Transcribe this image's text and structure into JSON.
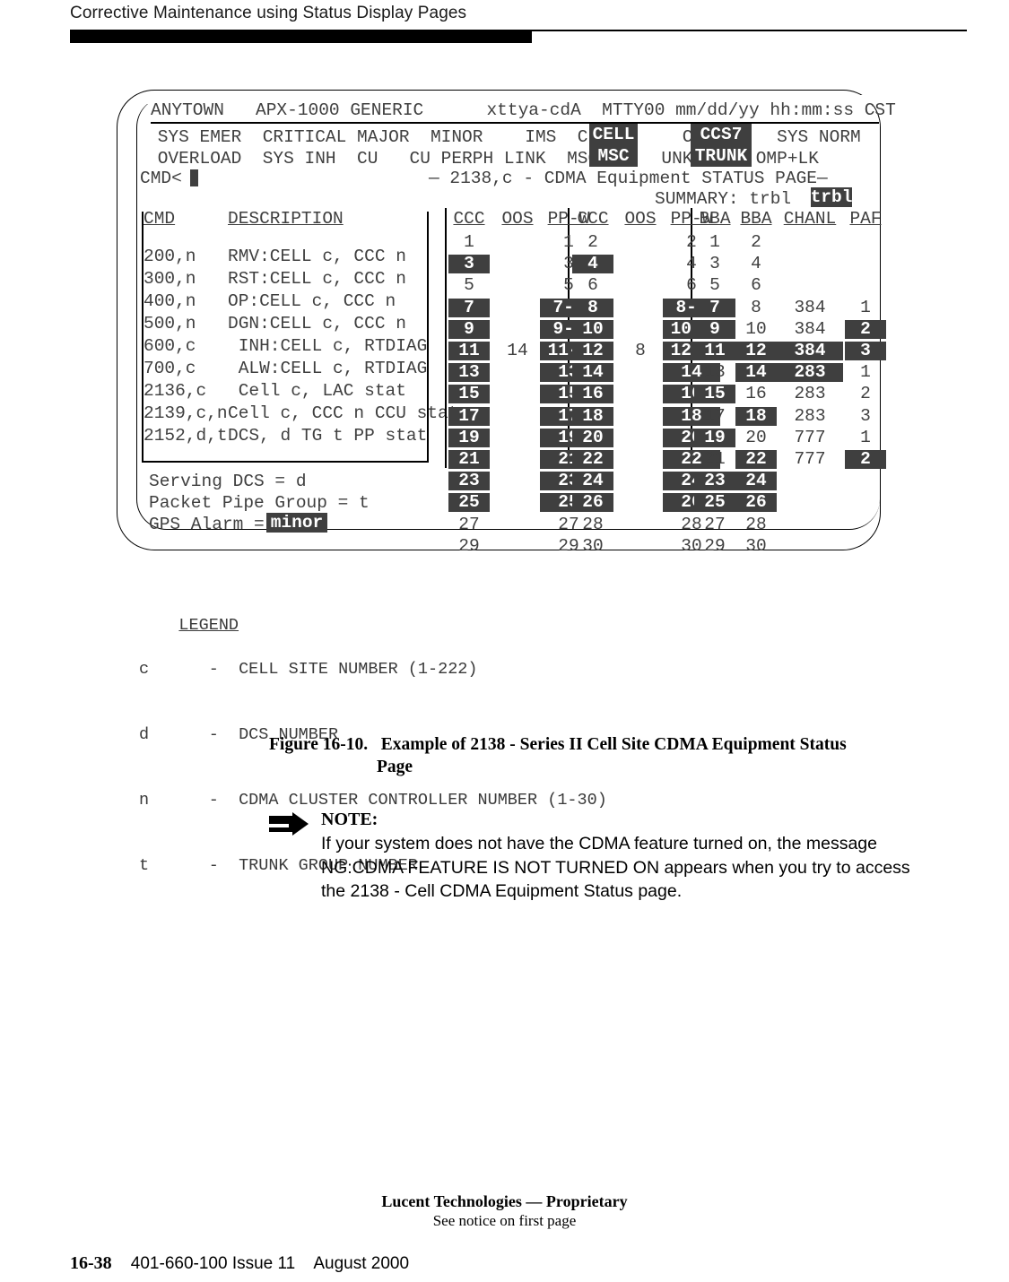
{
  "page": {
    "running_head": "Corrective Maintenance using Status Display Pages",
    "footer_proprietary": "Lucent Technologies — Proprietary",
    "footer_notice": "See notice on first page",
    "footer_page_number": "16-38",
    "footer_doc": "401-660-100 Issue 11",
    "footer_date": "August 2000"
  },
  "terminal": {
    "title_line": {
      "site": "ANYTOWN",
      "generic": "APX-1000 GENERIC",
      "terminal": "xttya-cdA",
      "mtty": "MTTY00",
      "date": "mm/dd/yy",
      "time": "hh:mm:ss",
      "zone": "CST",
      "full": "ANYTOWN   APX-1000 GENERIC      xttya-cdA  MTTY00 mm/dd/yy hh:mm:ss CST"
    },
    "alarm_banner": {
      "row1": " SYS EMER  CRITICAL MAJOR  MINOR    IMS  CELL      CS7      SYS NORM",
      "row2": " OVERLOAD  SYS INH  CU   CU PERPH LINK  MSC D    UNK      OMP+LK",
      "highlights": [
        {
          "line1": "CELL",
          "line2": "MSC"
        },
        {
          "line1": "CCS7",
          "line2": "TRUNK"
        }
      ]
    },
    "cmd_prompt": "CMD<",
    "page_title": "— 2138,c - CDMA Equipment STATUS PAGE—",
    "summary_label": "SUMMARY: trbl",
    "summary_value": "trbl",
    "cmd_table": {
      "headers": {
        "cmd": "CMD",
        "description": "DESCRIPTION"
      },
      "rows": [
        {
          "cmd": "200,n",
          "desc": "RMV:CELL c, CCC n"
        },
        {
          "cmd": "300,n",
          "desc": "RST:CELL c, CCC n"
        },
        {
          "cmd": "400,n",
          "desc": "OP:CELL c, CCC n"
        },
        {
          "cmd": "500,n",
          "desc": "DGN:CELL c, CCC n"
        },
        {
          "cmd": "600,c",
          "desc": " INH:CELL c, RTDIAG"
        },
        {
          "cmd": "700,c",
          "desc": " ALW:CELL c, RTDIAG"
        },
        {
          "cmd": "2136,c",
          "desc": " Cell c, LAC stat"
        },
        {
          "cmd": "2139,c,n",
          "desc": "Cell c, CCC n CCU stat"
        },
        {
          "cmd": "2152,d,t",
          "desc": "DCS, d TG t PP stat"
        }
      ]
    },
    "status_lines": [
      {
        "label": "Serving DCS = d",
        "value": null
      },
      {
        "label": "Packet Pipe Group = t",
        "value": null
      },
      {
        "label": "GPS Alarm = ",
        "value": "minor"
      }
    ],
    "matrix": {
      "group1": {
        "headers": [
          "CCC",
          "OOS",
          "PP-W"
        ],
        "ccc": [
          {
            "t": "1",
            "h": false
          },
          {
            "t": "3",
            "h": true
          },
          {
            "t": "5",
            "h": false
          },
          {
            "t": "7",
            "h": true
          },
          {
            "t": "9",
            "h": true
          },
          {
            "t": "11",
            "h": true
          },
          {
            "t": "13",
            "h": true
          },
          {
            "t": "15",
            "h": true
          },
          {
            "t": "17",
            "h": true
          },
          {
            "t": "19",
            "h": true
          },
          {
            "t": "21",
            "h": true
          },
          {
            "t": "23",
            "h": true
          },
          {
            "t": "25",
            "h": true
          },
          {
            "t": "27",
            "h": false
          },
          {
            "t": "29",
            "h": false
          }
        ],
        "oos": [
          {
            "t": "",
            "h": false
          },
          {
            "t": "",
            "h": false
          },
          {
            "t": "",
            "h": false
          },
          {
            "t": "",
            "h": false
          },
          {
            "t": "",
            "h": false
          },
          {
            "t": "14",
            "h": false
          },
          {
            "t": "",
            "h": false
          },
          {
            "t": "",
            "h": false
          },
          {
            "t": "",
            "h": false
          },
          {
            "t": "",
            "h": false
          },
          {
            "t": "",
            "h": false
          },
          {
            "t": "",
            "h": false
          },
          {
            "t": "",
            "h": false
          },
          {
            "t": "",
            "h": false
          },
          {
            "t": "",
            "h": false
          }
        ],
        "ppw": [
          {
            "t": "1",
            "h": false
          },
          {
            "t": "3",
            "h": false
          },
          {
            "t": "5",
            "h": false
          },
          {
            "t": "7-2",
            "h": true
          },
          {
            "t": "9-8",
            "h": true
          },
          {
            "t": "11-4",
            "h": true
          },
          {
            "t": "13",
            "h": true
          },
          {
            "t": "15",
            "h": true
          },
          {
            "t": "17",
            "h": true
          },
          {
            "t": "19",
            "h": true
          },
          {
            "t": "21",
            "h": true
          },
          {
            "t": "23",
            "h": true
          },
          {
            "t": "25",
            "h": true
          },
          {
            "t": "27",
            "h": false
          },
          {
            "t": "29",
            "h": false
          }
        ]
      },
      "group2": {
        "headers": [
          "CCC",
          "OOS",
          "PP-W"
        ],
        "ccc": [
          {
            "t": "2",
            "h": false
          },
          {
            "t": "4",
            "h": true
          },
          {
            "t": "6",
            "h": false
          },
          {
            "t": "8",
            "h": true
          },
          {
            "t": "10",
            "h": true
          },
          {
            "t": "12",
            "h": true
          },
          {
            "t": "14",
            "h": true
          },
          {
            "t": "16",
            "h": true
          },
          {
            "t": "18",
            "h": true
          },
          {
            "t": "20",
            "h": true
          },
          {
            "t": "22",
            "h": true
          },
          {
            "t": "24",
            "h": true
          },
          {
            "t": "26",
            "h": true
          },
          {
            "t": "28",
            "h": false
          },
          {
            "t": "30",
            "h": false
          }
        ],
        "oos": [
          {
            "t": "",
            "h": false
          },
          {
            "t": "",
            "h": false
          },
          {
            "t": "",
            "h": false
          },
          {
            "t": "",
            "h": false
          },
          {
            "t": "",
            "h": false
          },
          {
            "t": "8",
            "h": false
          },
          {
            "t": "",
            "h": false
          },
          {
            "t": "",
            "h": false
          },
          {
            "t": "",
            "h": false
          },
          {
            "t": "",
            "h": false
          },
          {
            "t": "",
            "h": false
          },
          {
            "t": "",
            "h": false
          },
          {
            "t": "",
            "h": false
          },
          {
            "t": "",
            "h": false
          },
          {
            "t": "",
            "h": false
          }
        ],
        "ppw": [
          {
            "t": "2",
            "h": false
          },
          {
            "t": "4",
            "h": false
          },
          {
            "t": "6",
            "h": false
          },
          {
            "t": "8-6",
            "h": true
          },
          {
            "t": "10-4",
            "h": true
          },
          {
            "t": "12-2",
            "h": true
          },
          {
            "t": "14",
            "h": true
          },
          {
            "t": "16",
            "h": true
          },
          {
            "t": "18",
            "h": true
          },
          {
            "t": "20",
            "h": true
          },
          {
            "t": "22",
            "h": true
          },
          {
            "t": "24",
            "h": true
          },
          {
            "t": "26",
            "h": true
          },
          {
            "t": "28",
            "h": false
          },
          {
            "t": "30",
            "h": false
          }
        ]
      },
      "group3": {
        "headers": [
          "BBA",
          "BBA",
          "CHANL",
          "PAF"
        ],
        "bba_odd": [
          {
            "t": "1",
            "h": false
          },
          {
            "t": "3",
            "h": false
          },
          {
            "t": "5",
            "h": false
          },
          {
            "t": "7",
            "h": true
          },
          {
            "t": "9",
            "h": true
          },
          {
            "t": "11",
            "h": true
          },
          {
            "t": "13",
            "h": false
          },
          {
            "t": "15",
            "h": true
          },
          {
            "t": "17",
            "h": false
          },
          {
            "t": "19",
            "h": true
          },
          {
            "t": "21",
            "h": false
          },
          {
            "t": "23",
            "h": true
          },
          {
            "t": "25",
            "h": true
          },
          {
            "t": "27",
            "h": false
          },
          {
            "t": "29",
            "h": false
          }
        ],
        "bba_even": [
          {
            "t": "2",
            "h": false
          },
          {
            "t": "4",
            "h": false
          },
          {
            "t": "6",
            "h": false
          },
          {
            "t": "8",
            "h": false
          },
          {
            "t": "10",
            "h": false
          },
          {
            "t": "12",
            "h": true
          },
          {
            "t": "14",
            "h": true
          },
          {
            "t": "16",
            "h": false
          },
          {
            "t": "18",
            "h": true
          },
          {
            "t": "20",
            "h": false
          },
          {
            "t": "22",
            "h": true
          },
          {
            "t": "24",
            "h": true
          },
          {
            "t": "26",
            "h": true
          },
          {
            "t": "28",
            "h": false
          },
          {
            "t": "30",
            "h": false
          }
        ],
        "chanl": [
          {
            "t": "",
            "h": false
          },
          {
            "t": "",
            "h": false
          },
          {
            "t": "",
            "h": false
          },
          {
            "t": "384",
            "h": false
          },
          {
            "t": "384",
            "h": false
          },
          {
            "t": "384",
            "h": true
          },
          {
            "t": "283",
            "h": true
          },
          {
            "t": "283",
            "h": false
          },
          {
            "t": "283",
            "h": false
          },
          {
            "t": "777",
            "h": false
          },
          {
            "t": "777",
            "h": false
          },
          {
            "t": "",
            "h": false
          },
          {
            "t": "",
            "h": false
          },
          {
            "t": "",
            "h": false
          },
          {
            "t": "",
            "h": false
          }
        ],
        "paf": [
          {
            "t": "",
            "h": false
          },
          {
            "t": "",
            "h": false
          },
          {
            "t": "",
            "h": false
          },
          {
            "t": "1",
            "h": false
          },
          {
            "t": "2",
            "h": true
          },
          {
            "t": "3",
            "h": true
          },
          {
            "t": "1",
            "h": false
          },
          {
            "t": "2",
            "h": false
          },
          {
            "t": "3",
            "h": false
          },
          {
            "t": "1",
            "h": false
          },
          {
            "t": "2",
            "h": true
          },
          {
            "t": "",
            "h": false
          },
          {
            "t": "",
            "h": false
          },
          {
            "t": "",
            "h": false
          },
          {
            "t": "",
            "h": false
          }
        ]
      }
    }
  },
  "legend": {
    "title": "LEGEND",
    "entries": [
      {
        "symbol": "c",
        "dash": "-",
        "meaning": "CELL SITE NUMBER (1-222)"
      },
      {
        "symbol": "d",
        "dash": "-",
        "meaning": "DCS NUMBER"
      },
      {
        "symbol": "n",
        "dash": "-",
        "meaning": "CDMA CLUSTER CONTROLLER NUMBER (1-30)"
      },
      {
        "symbol": "t",
        "dash": "-",
        "meaning": "TRUNK GROUP NUMBER"
      }
    ]
  },
  "caption": {
    "number": "Figure 16-10.",
    "line1": "Example of 2138 - Series II Cell Site CDMA Equipment Status",
    "line2": "Page"
  },
  "note": {
    "label": "NOTE:",
    "body": "If your system does not have the CDMA feature turned on, the message NG:CDMA FEATURE IS NOT TURNED ON appears when you try to access the 2138 - Cell CDMA Equipment Status page."
  },
  "colors": {
    "highlight_bg": "#3f3f3f",
    "highlight_fg": "#ffffff",
    "terminal_text": "#3f3f3f"
  }
}
